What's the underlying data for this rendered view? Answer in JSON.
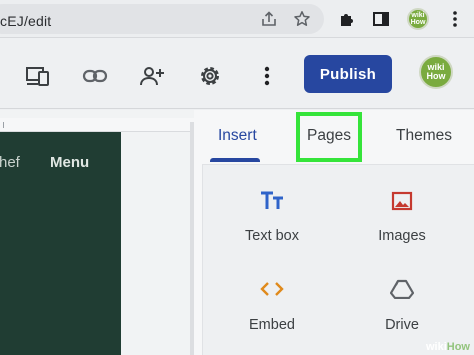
{
  "browser": {
    "url": "cEJ/edit",
    "extension_badge": "wiki How"
  },
  "toolbar": {
    "publish_label": "Publish",
    "avatar_text": "wiki How"
  },
  "canvas": {
    "nav_partial": "hef",
    "nav_menu": "Menu"
  },
  "panel": {
    "tabs": [
      {
        "label": "Insert",
        "active": true
      },
      {
        "label": "Pages",
        "active": false
      },
      {
        "label": "Themes",
        "active": false
      }
    ],
    "items": [
      {
        "label": "Text box",
        "icon": "text-box-icon"
      },
      {
        "label": "Images",
        "icon": "image-icon"
      },
      {
        "label": "Embed",
        "icon": "embed-icon"
      },
      {
        "label": "Drive",
        "icon": "drive-icon"
      }
    ]
  },
  "watermark": {
    "prefix": "wiki",
    "suffix": "How"
  },
  "colors": {
    "accent": "#2747a0",
    "highlight": "#35e43a",
    "site_bg": "#203d33"
  }
}
